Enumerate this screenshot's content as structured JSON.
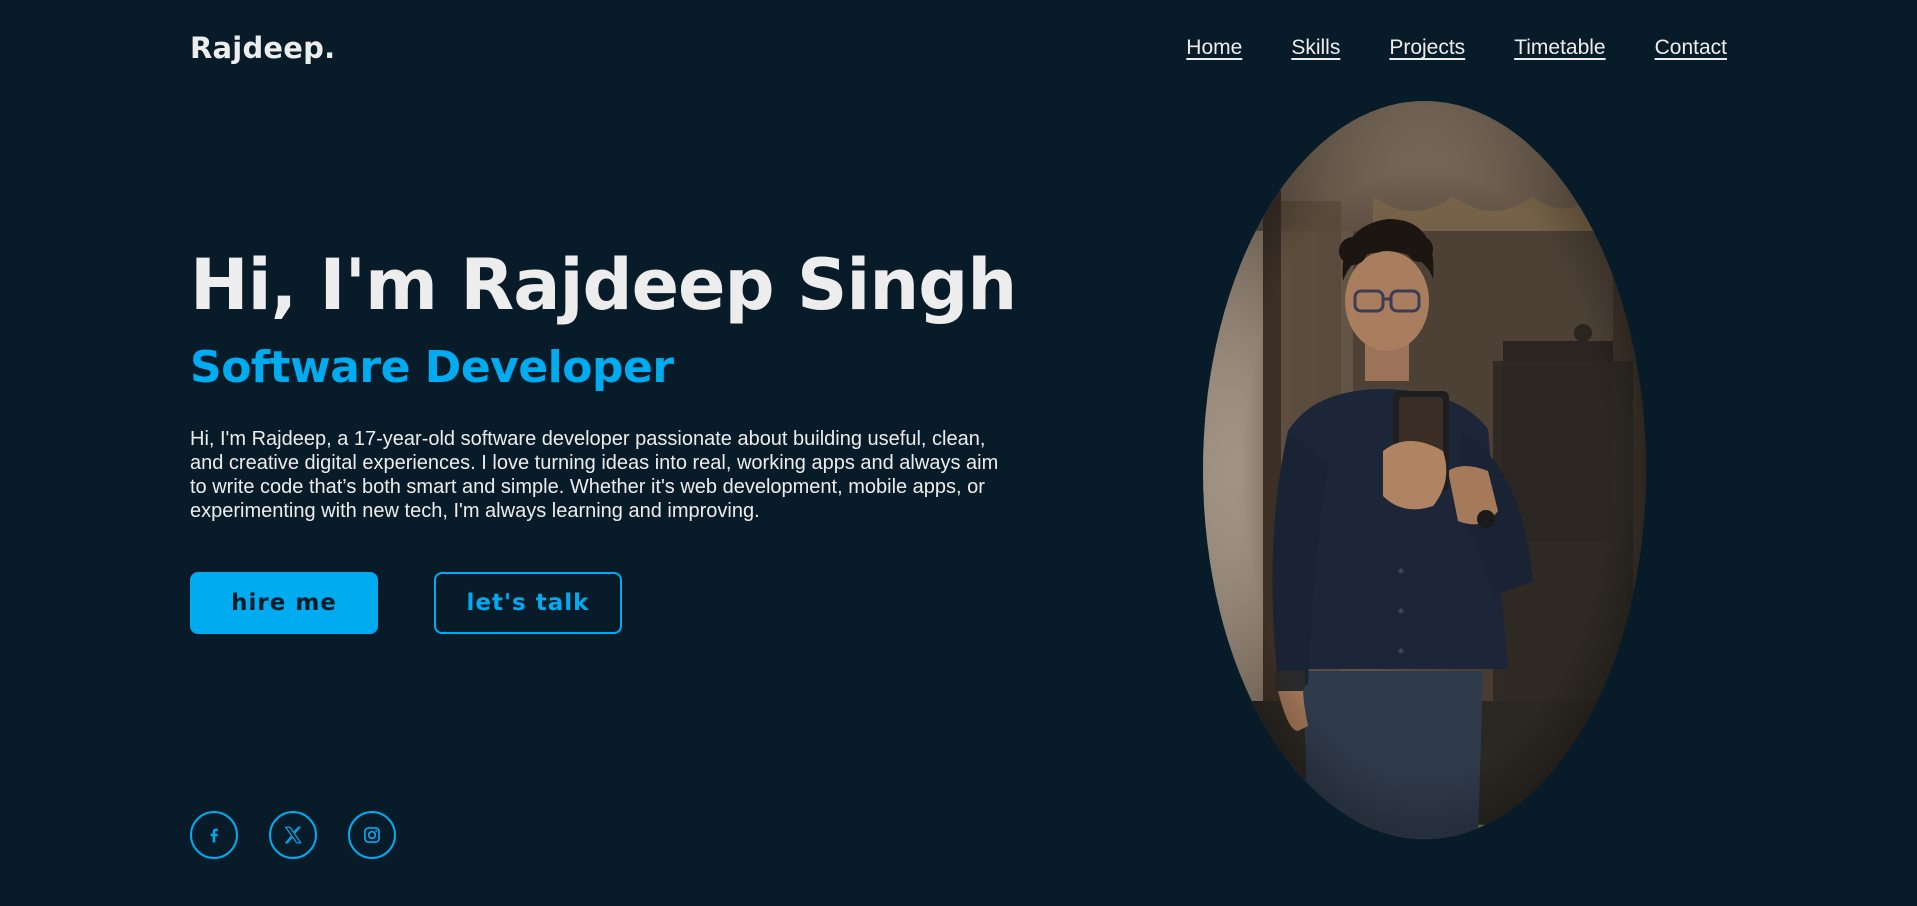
{
  "header": {
    "logo": "Rajdeep.",
    "nav": [
      "Home",
      "Skills",
      "Projects",
      "Timetable",
      "Contact"
    ]
  },
  "hero": {
    "heading": "Hi, I'm Rajdeep Singh",
    "subheading": "Software Developer",
    "bio": "Hi, I'm Rajdeep, a 17-year-old software developer passionate about building useful, clean, and creative digital experiences. I love turning ideas into real, working apps and always aim to write code that’s both smart and simple. Whether it's web development, mobile apps, or experimenting with new tech, I'm always learning and improving.",
    "primary_button": "hire me",
    "secondary_button": "let's talk"
  },
  "socials": [
    {
      "icon": "facebook-icon"
    },
    {
      "icon": "x-twitter-icon"
    },
    {
      "icon": "instagram-icon"
    }
  ],
  "colors": {
    "background": "#081b29",
    "accent": "#00abf0",
    "text": "#ededed"
  }
}
